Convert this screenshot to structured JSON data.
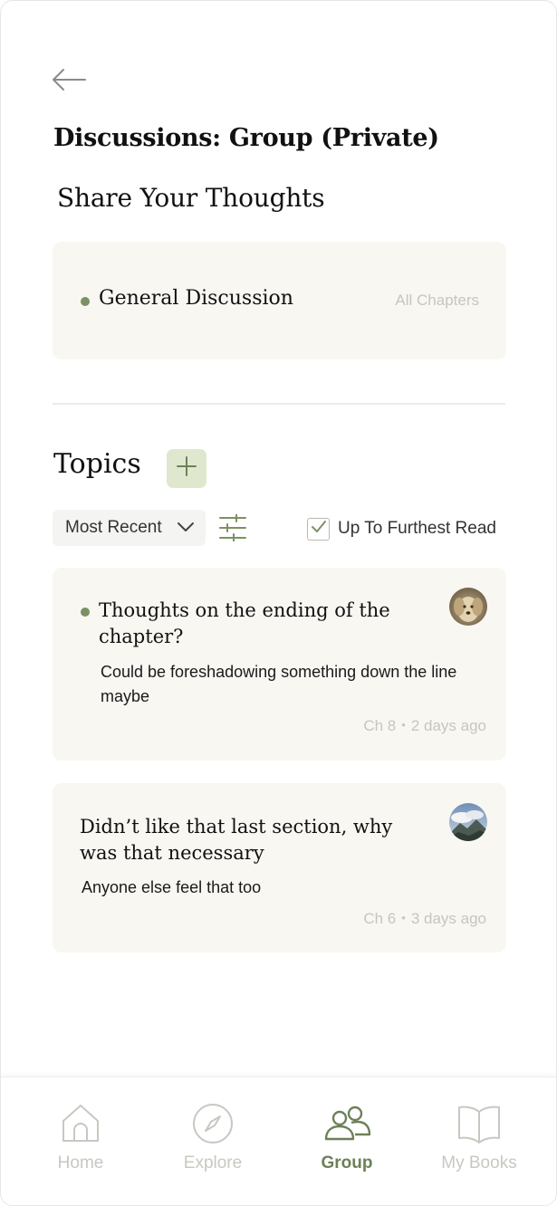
{
  "header": {
    "back_icon": "arrow-left-icon",
    "title": "Discussions: Group (Private)",
    "section_title": "Share Your Thoughts"
  },
  "general_discussion": {
    "title": "General Discussion",
    "scope": "All Chapters",
    "status_color": "#7c9064"
  },
  "topics": {
    "heading": "Topics",
    "add_icon": "plus-icon",
    "sort": {
      "selected": "Most Recent"
    },
    "filter_icon": "sliders-icon",
    "furthest_read": {
      "label": "Up To Furthest Read",
      "checked": true
    },
    "items": [
      {
        "title": "Thoughts on the ending of the chapter?",
        "body": "Could be foreshadowing something down the line maybe",
        "chapter": "Ch 8",
        "time": "2 days ago",
        "unread": true,
        "avatar": "dog-avatar"
      },
      {
        "title": "Didn’t like that last section, why was that necessary",
        "body": "Anyone else feel that too",
        "chapter": "Ch 6",
        "time": "3 days ago",
        "unread": false,
        "avatar": "mountain-avatar"
      }
    ]
  },
  "nav": {
    "active": "Group",
    "items": [
      {
        "label": "Home",
        "icon": "home-icon"
      },
      {
        "label": "Explore",
        "icon": "compass-icon"
      },
      {
        "label": "Group",
        "icon": "group-icon"
      },
      {
        "label": "My Books",
        "icon": "book-icon"
      }
    ]
  },
  "colors": {
    "accent": "#7c9064",
    "accent_dark": "#6d8058",
    "card_bg": "#f8f7f2",
    "add_button_bg": "#dfe8cf"
  }
}
